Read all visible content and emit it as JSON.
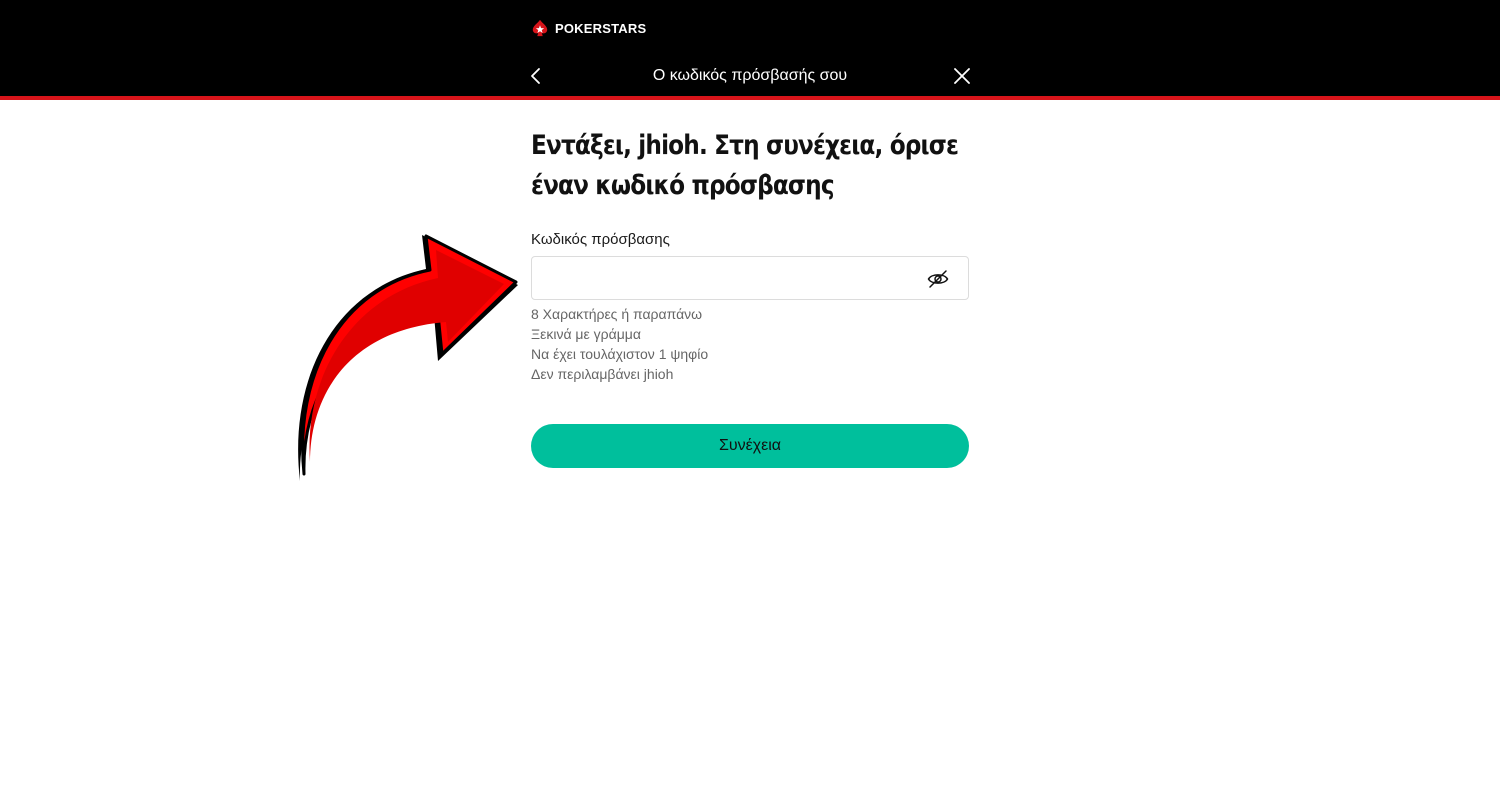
{
  "header": {
    "logo_text": "POKERSTARS",
    "title": "Ο κωδικός πρόσβασής σου",
    "back_icon": "chevron-left-icon",
    "close_icon": "close-icon",
    "bar_color": "#000000",
    "accent_color": "#d7141a"
  },
  "main": {
    "headline": "Εντάξει, jhioh. Στη συνέχεια, όρισε έναν κωδικό πρόσβασης",
    "password_field": {
      "label": "Κωδικός πρόσβασης",
      "value": "",
      "toggle_icon": "eye-off-icon"
    },
    "rules": [
      "8 Χαρακτήρες ή παραπάνω",
      "Ξεκινά με γράμμα",
      "Να έχει τουλάχιστον 1 ψηφίο",
      "Δεν περιλαμβάνει jhioh"
    ],
    "continue_label": "Συνέχεια",
    "button_color": "#00bf9c"
  },
  "overlay": {
    "arrow_icon": "curved-arrow-icon",
    "arrow_color": "#ff0000"
  }
}
